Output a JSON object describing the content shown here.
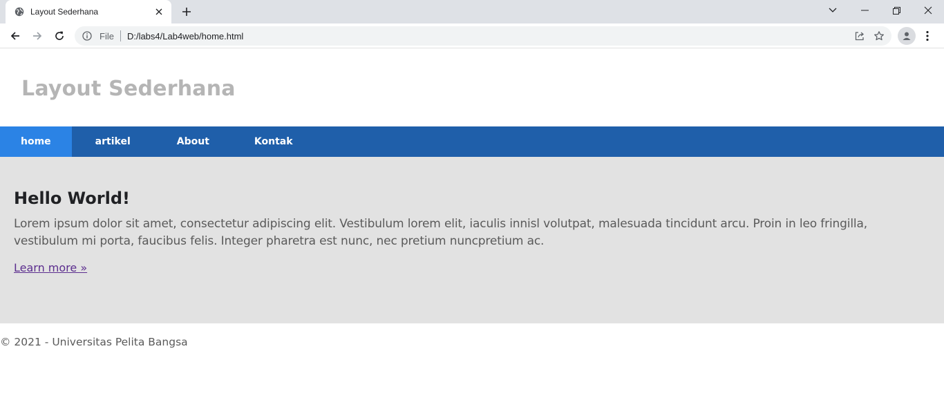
{
  "browser": {
    "tab_title": "Layout Sederhana",
    "omnibox_scheme": "File",
    "url": "D:/labs4/Lab4web/home.html"
  },
  "site": {
    "title": "Layout Sederhana",
    "nav": [
      "home",
      "artikel",
      "About",
      "Kontak"
    ],
    "active_nav": "home"
  },
  "hero": {
    "heading": "Hello World!",
    "paragraph": "Lorem ipsum dolor sit amet, consectetur adipiscing elit. Vestibulum lorem elit, iaculis innisl volutpat, malesuada tincidunt arcu. Proin in leo fringilla, vestibulum mi porta, faucibus felis. Integer pharetra est nunc, nec pretium nuncpretium ac.",
    "link": "Learn more »"
  },
  "footer": {
    "text": "© 2021 - Universitas Pelita Bangsa"
  },
  "colors": {
    "nav_bg": "#1f5faa",
    "nav_active": "#2b83e5",
    "hero_bg": "#e2e2e2",
    "title": "#b5b5b5",
    "link": "#5b2d8e"
  }
}
